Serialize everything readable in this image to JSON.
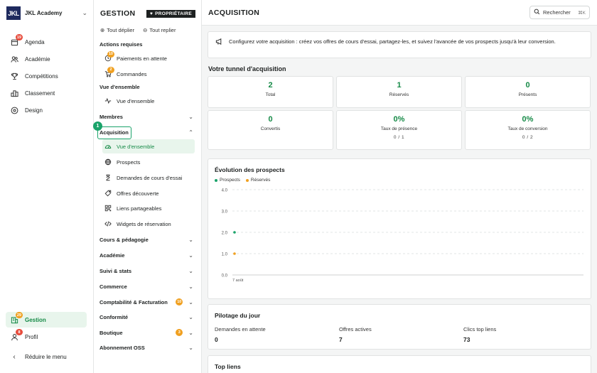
{
  "app": {
    "logo": "JKL",
    "name": "JKL Academy",
    "nav": [
      {
        "label": "Agenda",
        "badge": "19"
      },
      {
        "label": "Académie"
      },
      {
        "label": "Compétitions"
      },
      {
        "label": "Classement"
      },
      {
        "label": "Design"
      }
    ],
    "bottom_nav": [
      {
        "label": "Gestion",
        "badge": "29"
      },
      {
        "label": "Profil",
        "badge": "8"
      },
      {
        "label": "Réduire le menu"
      }
    ]
  },
  "panel": {
    "title": "GESTION",
    "owner_badge": "PROPRIÉTAIRE",
    "expand_all": "Tout déplier",
    "collapse_all": "Tout replier",
    "required_title": "Actions requises",
    "required_items": [
      {
        "label": "Paiements en attente",
        "badge": "10"
      },
      {
        "label": "Commandes",
        "badge": "2"
      }
    ],
    "overview_title": "Vue d'ensemble",
    "overview_item": "Vue d'ensemble",
    "members": "Membres",
    "acquisition": "Acquisition",
    "acquisition_items": [
      "Vue d'ensemble",
      "Prospects",
      "Demandes de cours d'essai",
      "Offres découverte",
      "Liens partageables",
      "Widgets de réservation"
    ],
    "sections": [
      {
        "label": "Cours & pédagogie"
      },
      {
        "label": "Académie"
      },
      {
        "label": "Suivi & stats"
      },
      {
        "label": "Commerce"
      },
      {
        "label": "Comptabilité & Facturation",
        "badge": "10"
      },
      {
        "label": "Conformité"
      },
      {
        "label": "Boutique",
        "badge": "3"
      },
      {
        "label": "Abonnement OSS"
      }
    ],
    "step_number": "1"
  },
  "main": {
    "title": "ACQUISITION",
    "search_label": "Rechercher",
    "search_kbd": "⌘K",
    "info": "Configurez votre acquisition : créez vos offres de cours d'essai, partagez-les, et suivez l'avancée de vos prospects jusqu'à leur conversion.",
    "funnel_title": "Votre tunnel d'acquisition",
    "funnel": [
      {
        "value": "2",
        "label": "Total"
      },
      {
        "value": "1",
        "label": "Réservés"
      },
      {
        "value": "0",
        "label": "Présents"
      },
      {
        "value": "0",
        "label": "Convertis"
      },
      {
        "value": "0%",
        "label": "Taux de présence",
        "detail": "0 / 1"
      },
      {
        "value": "0%",
        "label": "Taux de conversion",
        "detail": "0 / 2"
      }
    ],
    "pilot_title": "Pilotage du jour",
    "pilot": [
      {
        "label": "Demandes en attente",
        "value": "0"
      },
      {
        "label": "Offres actives",
        "value": "7"
      },
      {
        "label": "Clics top liens",
        "value": "73"
      }
    ],
    "top_links_title": "Top liens"
  },
  "chart_data": {
    "type": "scatter",
    "title": "Évolution des prospects",
    "x": [
      "7 août"
    ],
    "series": [
      {
        "name": "Prospects",
        "values": [
          2
        ],
        "color": "#1aa36a"
      },
      {
        "name": "Réservés",
        "values": [
          1
        ],
        "color": "#f0a020"
      }
    ],
    "yticks": [
      "0.0",
      "1.0",
      "2.0",
      "3.0",
      "4.0"
    ],
    "ylim": [
      0,
      4
    ],
    "grid": true,
    "legend": "top-left"
  }
}
